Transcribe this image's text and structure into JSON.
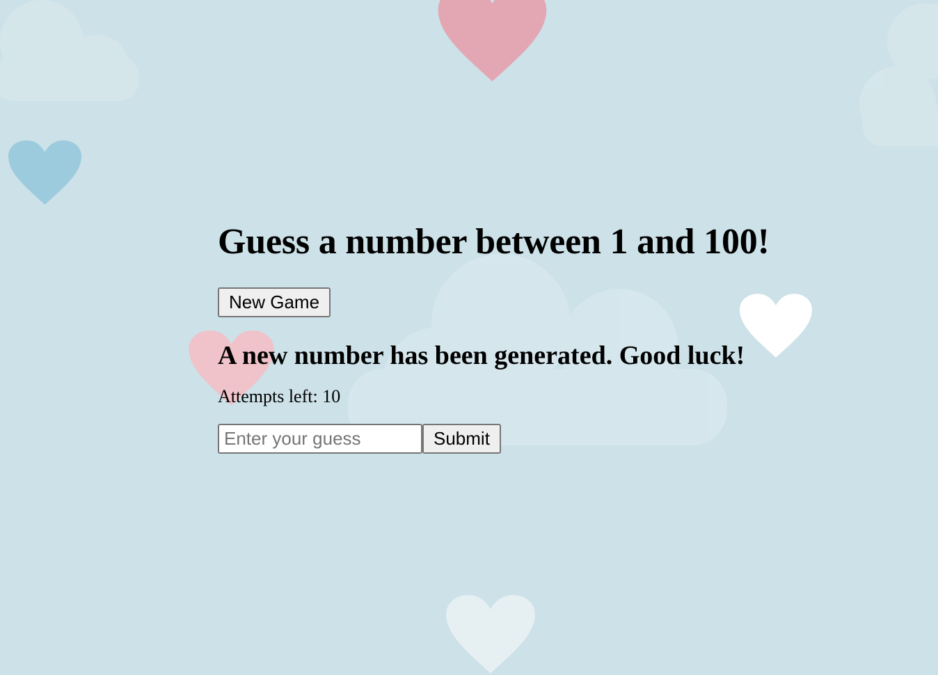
{
  "game": {
    "title": "Guess a number between 1 and 100!",
    "new_game_label": "New Game",
    "message": "A new number has been generated. Good luck!",
    "attempts_text": "Attempts left: 10",
    "guess_placeholder": "Enter your guess",
    "guess_value": "",
    "submit_label": "Submit"
  },
  "background": {
    "base_color": "#cde1e8",
    "decorations": [
      "heart-icon",
      "cloud-icon"
    ],
    "heart_colors": [
      "#e3a7b4",
      "#9ccbdd",
      "#ffffff",
      "#f0c2c9"
    ]
  }
}
